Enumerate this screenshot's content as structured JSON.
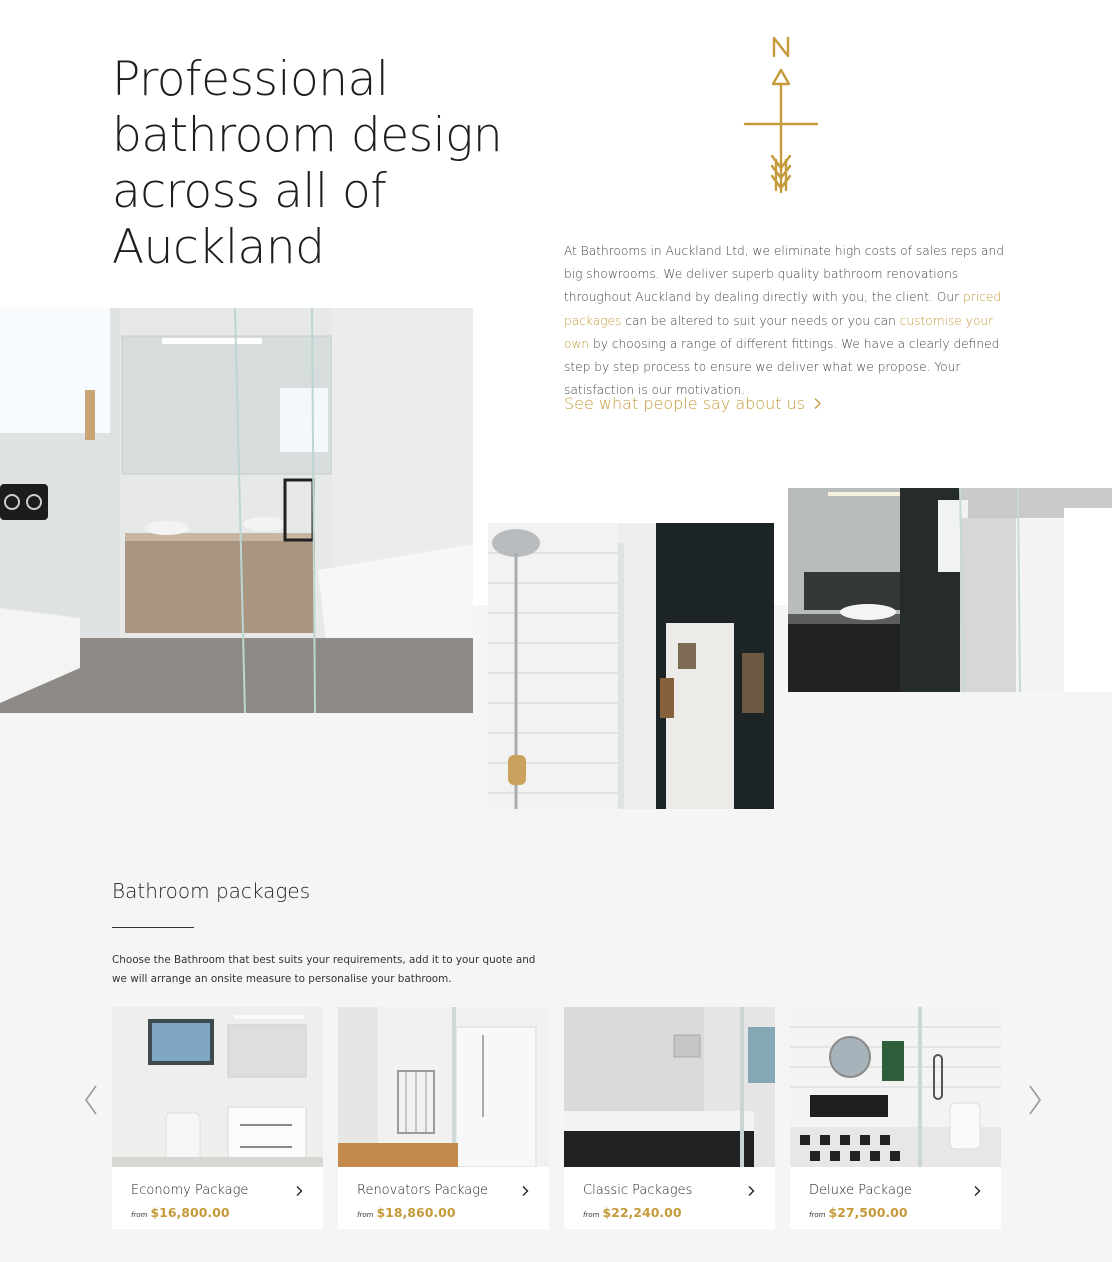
{
  "hero": {
    "title": "Professional bathroom design across all of Auckland",
    "logo_icon": "compass-arrow-icon",
    "logo_letter": "N"
  },
  "intro": {
    "part1": "At Bathrooms in Auckland Ltd, we eliminate high costs of sales reps and big showrooms. We deliver superb quality bathroom renovations throughout Auckland by dealing directly with you, the client. Our ",
    "link1": "priced packages",
    "part2": " can be altered to suit your needs or you can ",
    "link2": "customise your own",
    "part3": " by choosing a range of different fittings. We have a clearly defined step by step process to ensure we deliver what we propose. Your satisfaction is our motivation.",
    "testimonial_link": "See what people say about us"
  },
  "packages": {
    "heading": "Bathroom packages",
    "description": "Choose the Bathroom that best suits your requirements, add it to your quote and we will arrange an onsite measure to personalise your bathroom.",
    "prev_icon": "chevron-left-icon",
    "next_icon": "chevron-right-icon",
    "items": [
      {
        "name": "Economy Package",
        "from": "from",
        "price": "$16,800.00"
      },
      {
        "name": "Renovators Package",
        "from": "from",
        "price": "$18,860.00"
      },
      {
        "name": "Classic Packages",
        "from": "from",
        "price": "$22,240.00"
      },
      {
        "name": "Deluxe Package",
        "from": "from",
        "price": "$27,500.00"
      }
    ]
  },
  "colors": {
    "accent_gold": "#c49a3a",
    "band_grey": "#f5f5f5",
    "text_dark": "#222222"
  }
}
